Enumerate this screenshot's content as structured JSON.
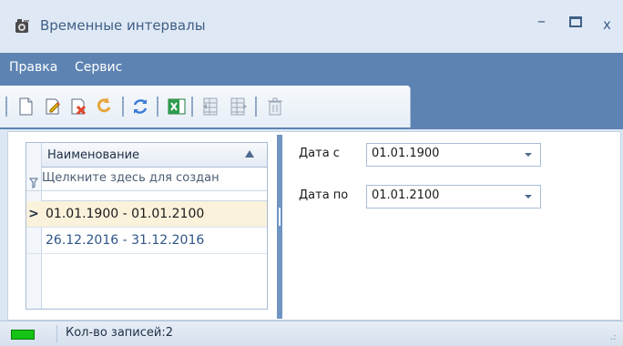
{
  "window": {
    "title": "Временные интервалы",
    "minimize_label": "–",
    "close_label": "x"
  },
  "menu": {
    "items": [
      "Правка",
      "Сервис"
    ]
  },
  "toolbar": {
    "buttons": [
      {
        "icon": "new-document-icon"
      },
      {
        "icon": "edit-document-icon"
      },
      {
        "icon": "delete-document-icon"
      },
      {
        "icon": "undo-icon"
      },
      {
        "icon": "refresh-icon"
      },
      {
        "icon": "excel-export-icon"
      },
      {
        "icon": "grid-left-icon"
      },
      {
        "icon": "grid-right-icon"
      },
      {
        "icon": "trash-icon"
      }
    ]
  },
  "grid": {
    "column_header": "Наименование",
    "filter_placeholder": "Щелкните здесь для создан",
    "current_row_marker": ">",
    "rows": [
      {
        "text": "01.01.1900 - 01.01.2100",
        "selected": true
      },
      {
        "text": "26.12.2016 - 31.12.2016",
        "selected": false
      }
    ]
  },
  "filters": {
    "date_from": {
      "label": "Дата с",
      "value": "01.01.1900"
    },
    "date_to": {
      "label": "Дата по",
      "value": "01.01.2100"
    }
  },
  "status": {
    "record_count": "Кол-во записей:2",
    "grip": ".:"
  },
  "colors": {
    "menu_bar": "#5d83b2",
    "selected_row": "#fbf2dc",
    "status_led": "#14c414"
  }
}
